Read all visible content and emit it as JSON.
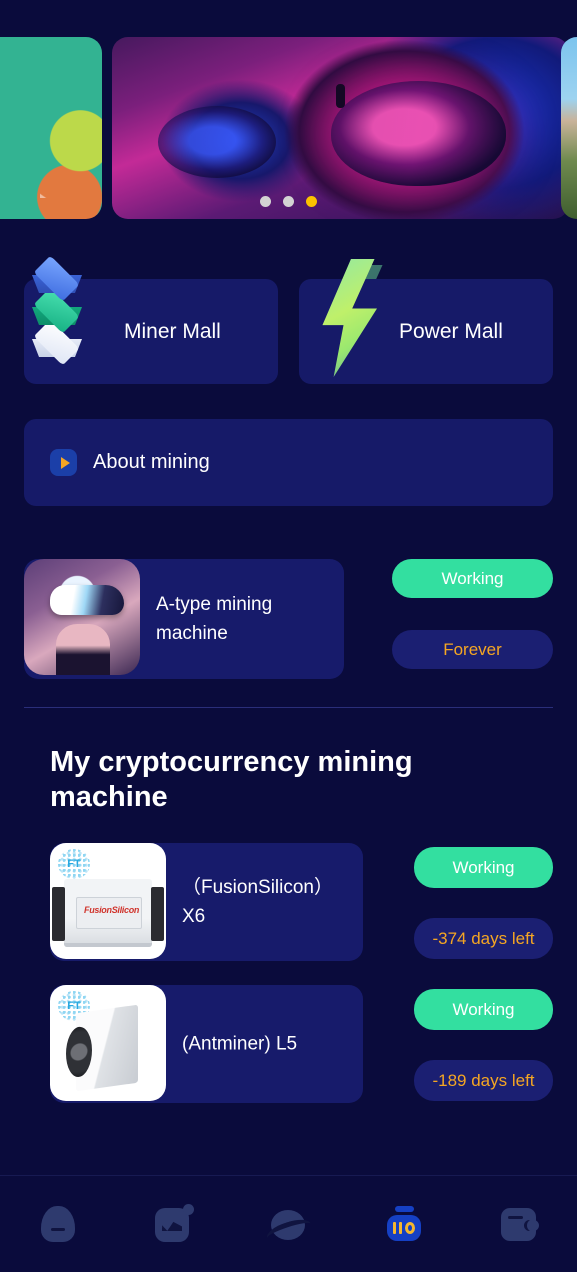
{
  "carousel": {
    "slides": [
      {
        "name": "app-icons-teal-slide"
      },
      {
        "name": "vr-headset-neon-slide"
      },
      {
        "name": "landscape-slide"
      }
    ],
    "dots": [
      {
        "active": false
      },
      {
        "active": false
      },
      {
        "active": true
      }
    ],
    "active_index": 2
  },
  "malls": [
    {
      "id": "miner",
      "label": "Miner Mall",
      "icon": "stacked-cubes-icon"
    },
    {
      "id": "power",
      "label": "Power Mall",
      "icon": "lightning-bolt-icon"
    }
  ],
  "about": {
    "label": "About mining",
    "icon": "play-icon"
  },
  "featured_machine": {
    "name": "A-type mining machine",
    "status": "Working",
    "term": "Forever",
    "thumb": "vr-woman-avatar"
  },
  "section": {
    "title": "My cryptocurrency mining machine"
  },
  "machines": [
    {
      "name": "（FusionSilicon）X6",
      "status": "Working",
      "days_left": "-374 days left",
      "thumb": "fusionsilicon-x6-photo",
      "watermark": "FT"
    },
    {
      "name": "(Antminer) L5",
      "status": "Working",
      "days_left": "-189 days left",
      "thumb": "antminer-l5-photo",
      "watermark": "FT"
    }
  ],
  "bottom_nav": [
    {
      "id": "home",
      "icon": "home-icon",
      "active": false
    },
    {
      "id": "market",
      "icon": "chart-icon",
      "active": false
    },
    {
      "id": "discover",
      "icon": "planet-icon",
      "active": false
    },
    {
      "id": "mining",
      "icon": "mining-machine-icon",
      "active": true
    },
    {
      "id": "wallet",
      "icon": "wallet-icon",
      "active": false
    }
  ],
  "colors": {
    "background": "#0a0b3c",
    "card": "#161a68",
    "accent_green": "#33dfa0",
    "accent_orange": "#f5a623",
    "accent_blue": "#1540c4",
    "dot_active": "#fcc200"
  }
}
